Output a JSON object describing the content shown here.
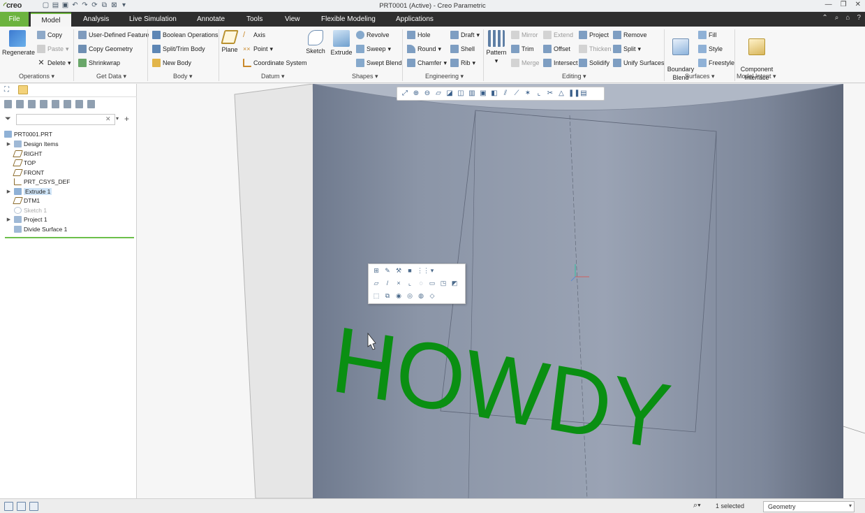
{
  "app": {
    "logo": "creo",
    "window_title": "PRT0001 (Active) - Creo Parametric"
  },
  "qat_icons": [
    "new-icon",
    "open-icon",
    "save-icon",
    "undo-icon",
    "redo-icon",
    "regenerate-icon",
    "windows-icon",
    "close-window-icon",
    "customize-icon"
  ],
  "menu": {
    "file": "File",
    "model": "Model",
    "analysis": "Analysis",
    "live_sim": "Live Simulation",
    "annotate": "Annotate",
    "tools": "Tools",
    "view": "View",
    "flex": "Flexible Modeling",
    "applications": "Applications"
  },
  "ribbon": {
    "regenerate": "Regenerate",
    "copy": "Copy",
    "paste": "Paste",
    "delete": "Delete",
    "udf": "User-Defined Feature",
    "copy_geometry": "Copy Geometry",
    "shrinkwrap": "Shrinkwrap",
    "boolean": "Boolean Operations",
    "split_trim": "Split/Trim Body",
    "new_body": "New Body",
    "plane": "Plane",
    "axis": "Axis",
    "point": "Point",
    "coord_sys": "Coordinate System",
    "sketch": "Sketch",
    "extrude": "Extrude",
    "revolve": "Revolve",
    "sweep": "Sweep",
    "swept_blend": "Swept Blend",
    "hole": "Hole",
    "round": "Round",
    "chamfer": "Chamfer",
    "draft": "Draft",
    "shell": "Shell",
    "rib": "Rib",
    "pattern": "Pattern",
    "mirror": "Mirror",
    "trim": "Trim",
    "merge": "Merge",
    "extend": "Extend",
    "offset": "Offset",
    "intersect": "Intersect",
    "project": "Project",
    "thicken": "Thicken",
    "solidify": "Solidify",
    "remove": "Remove",
    "split": "Split",
    "unify": "Unify Surfaces",
    "boundary_blend": "Boundary\nBlend",
    "fill": "Fill",
    "style": "Style",
    "freestyle": "Freestyle",
    "component_interface": "Component\nInterface",
    "groups": {
      "operations": "Operations",
      "get_data": "Get Data",
      "body": "Body",
      "datum": "Datum",
      "shapes": "Shapes",
      "engineering": "Engineering",
      "editing": "Editing",
      "surfaces": "Surfaces",
      "model_intent": "Model Intent"
    }
  },
  "tree": {
    "filter_placeholder": "",
    "items": [
      {
        "label": "PRT0001.PRT"
      },
      {
        "label": "Design Items"
      },
      {
        "label": "RIGHT"
      },
      {
        "label": "TOP"
      },
      {
        "label": "FRONT"
      },
      {
        "label": "PRT_CSYS_DEF"
      },
      {
        "label": "Extrude 1"
      },
      {
        "label": "DTM1"
      },
      {
        "label": "Sketch 1"
      },
      {
        "label": "Project 1"
      },
      {
        "label": "Divide Surface 1"
      }
    ]
  },
  "viewport": {
    "text": "HOWDY",
    "text_color": "#0a8f12",
    "surface_color": "#8e98aa"
  },
  "status": {
    "selected": "1 selected",
    "filter": "Geometry"
  },
  "colors": {
    "accent": "#6cb33e",
    "menubar": "#2e2e2e"
  }
}
